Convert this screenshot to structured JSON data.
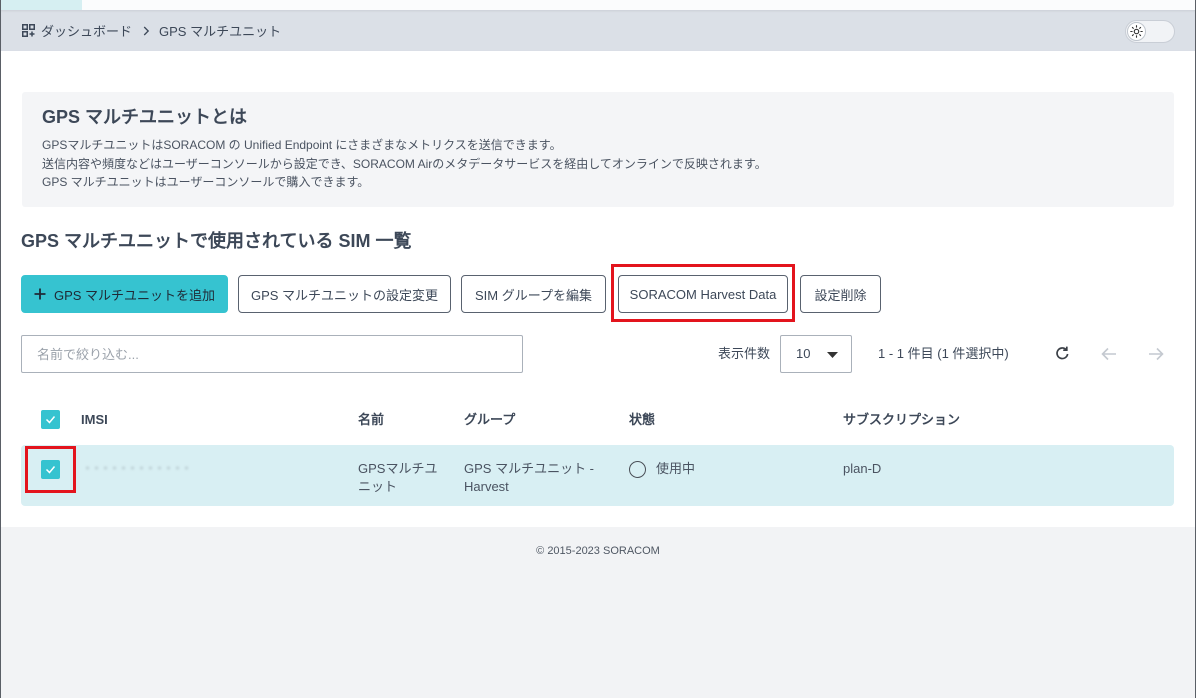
{
  "header": {
    "breadcrumb": [
      "ダッシュボード",
      "GPS マルチユニット"
    ],
    "breadcrumb_icon": "dashboard-icon",
    "separator_icon": "chevron-right-icon",
    "theme_toggle": {
      "icon": "sun-icon",
      "state": "light"
    }
  },
  "info": {
    "title": "GPS マルチユニットとは",
    "lines": [
      "GPSマルチユニットはSORACOM の Unified Endpoint にさまざまなメトリクスを送信できます。",
      "送信内容や頻度などはユーザーコンソールから設定でき、SORACOM Airのメタデータサービスを経由してオンラインで反映されます。",
      "GPS マルチユニットはユーザーコンソールで購入できます。"
    ]
  },
  "section_title": "GPS マルチユニットで使用されている SIM 一覧",
  "toolbar": {
    "add_icon": "plus-icon",
    "add_label": "GPS マルチユニットを追加",
    "settings_label": "GPS マルチユニットの設定変更",
    "edit_group_label": "SIM グループを編集",
    "harvest_label": "SORACOM Harvest Data",
    "delete_label": "設定削除"
  },
  "filter": {
    "placeholder": "名前で絞り込む..."
  },
  "pagination": {
    "per_page_label": "表示件数",
    "per_page_value": "10",
    "per_page_icon": "caret-down-icon",
    "range_text": "1 - 1 件目 (1 件選択中)",
    "refresh_icon": "refresh-icon",
    "prev_icon": "arrow-left-icon",
    "next_icon": "arrow-right-icon",
    "prev_enabled": false,
    "next_enabled": false
  },
  "table": {
    "select_all_checked": true,
    "columns": [
      "IMSI",
      "名前",
      "グループ",
      "状態",
      "サブスクリプション"
    ],
    "rows": [
      {
        "checked": true,
        "imsi_redacted": true,
        "name": "GPSマルチユニット",
        "group": "GPS マルチユニット - Harvest",
        "status_icon": "circle-outline-icon",
        "status": "使用中",
        "subscription": "plan-D"
      }
    ]
  },
  "footer": {
    "copyright": "© 2015-2023 SORACOM"
  },
  "colors": {
    "primary": "#36c3d0",
    "highlight_red": "#e3141d",
    "selected_row": "#d8eff3",
    "header_bg": "#dbe0e7",
    "info_bg": "#f4f5f7",
    "text": "#3d4858",
    "footer_bg": "#f2f3f5"
  }
}
